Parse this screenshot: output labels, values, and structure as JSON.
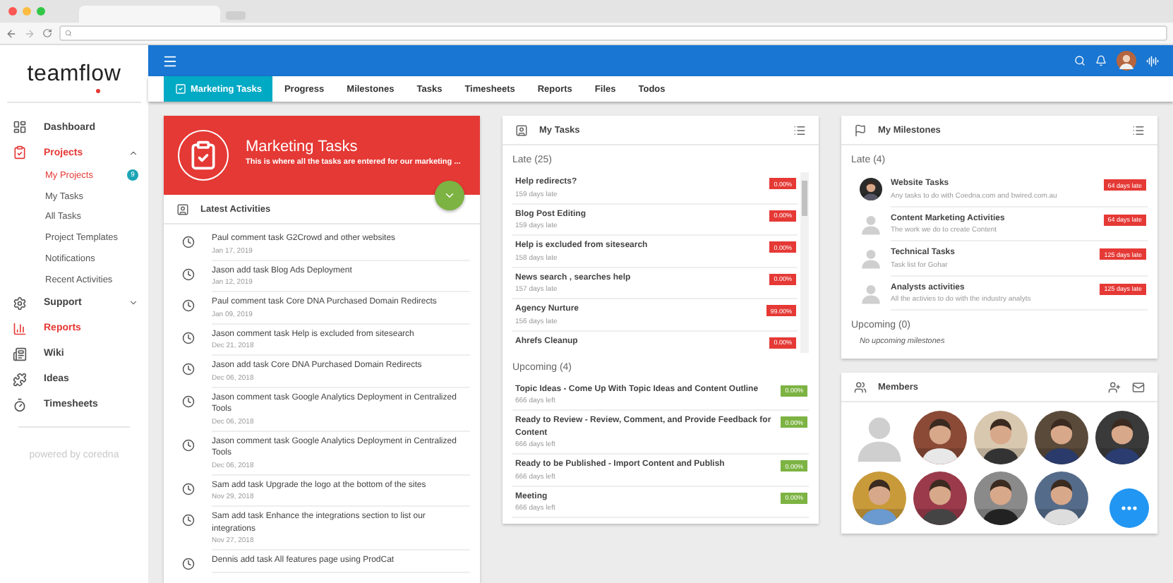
{
  "sidebar": {
    "logo": "teamflow",
    "items": [
      {
        "label": "Dashboard",
        "selected": false
      },
      {
        "label": "Projects",
        "selected": true,
        "expanded": true,
        "children": [
          {
            "label": "My Projects",
            "selected": true,
            "badge": "9"
          },
          {
            "label": "My Tasks",
            "selected": false
          },
          {
            "label": "All Tasks",
            "selected": false
          },
          {
            "label": "Project Templates",
            "selected": false
          },
          {
            "label": "Notifications",
            "selected": false
          },
          {
            "label": "Recent Activities",
            "selected": false
          }
        ]
      },
      {
        "label": "Support",
        "selected": false,
        "expanded": false
      },
      {
        "label": "Reports",
        "selected": true
      },
      {
        "label": "Wiki",
        "selected": false
      },
      {
        "label": "Ideas",
        "selected": false
      },
      {
        "label": "Timesheets",
        "selected": false
      }
    ],
    "footer": "powered by coredna"
  },
  "tabs": [
    {
      "label": "Marketing Tasks",
      "selected": true
    },
    {
      "label": "Progress",
      "selected": false
    },
    {
      "label": "Milestones",
      "selected": false
    },
    {
      "label": "Tasks",
      "selected": false
    },
    {
      "label": "Timesheets",
      "selected": false
    },
    {
      "label": "Reports",
      "selected": false
    },
    {
      "label": "Files",
      "selected": false
    },
    {
      "label": "Todos",
      "selected": false
    }
  ],
  "project": {
    "title": "Marketing Tasks",
    "description": "This is where all the tasks are entered for our marketing ..."
  },
  "activities": {
    "title": "Latest Activities",
    "items": [
      {
        "text": "Paul comment task G2Crowd and other websites",
        "date": "Jan 17, 2019"
      },
      {
        "text": "Jason add task Blog Ads Deployment",
        "date": "Jan 12, 2019"
      },
      {
        "text": "Paul comment task Core DNA Purchased Domain Redirects",
        "date": "Jan 09, 2019"
      },
      {
        "text": "Jason comment task Help is excluded from sitesearch",
        "date": "Dec 21, 2018"
      },
      {
        "text": "Jason add task Core DNA Purchased Domain Redirects",
        "date": "Dec 06, 2018"
      },
      {
        "text": "Jason comment task Google Analytics Deployment in Centralized Tools",
        "date": "Dec 06, 2018"
      },
      {
        "text": "Jason comment task Google Analytics Deployment in Centralized Tools",
        "date": "Dec 06, 2018"
      },
      {
        "text": "Sam add task Upgrade the logo at the bottom of the sites",
        "date": "Nov 29, 2018"
      },
      {
        "text": "Sam add task Enhance the integrations section to list our integrations",
        "date": "Nov 27, 2018"
      },
      {
        "text": "Dennis add task All features page using ProdCat"
      }
    ]
  },
  "my_tasks": {
    "title": "My Tasks",
    "sections": [
      {
        "kind": "late",
        "heading": "Late (25)",
        "tasks": [
          {
            "title": "Help redirects?",
            "due": "159 days late",
            "progress": "0.00%"
          },
          {
            "title": "Blog Post Editing",
            "due": "159 days late",
            "progress": "0.00%"
          },
          {
            "title": "Help is excluded from sitesearch",
            "due": "158 days late",
            "progress": "0.00%"
          },
          {
            "title": "News search , searches help",
            "due": "157 days late",
            "progress": "0.00%"
          },
          {
            "title": "Agency Nurture",
            "due": "156 days late",
            "progress": "99.00%"
          },
          {
            "title": "Ahrefs Cleanup",
            "progress": "0.00%"
          }
        ]
      },
      {
        "kind": "upcoming",
        "heading": "Upcoming (4)",
        "tasks": [
          {
            "title": "Topic Ideas - Come Up With Topic Ideas and Content Outline",
            "due": "666 days left",
            "progress": "0.00%"
          },
          {
            "title": "Ready to Review - Review, Comment, and Provide Feedback for Content",
            "due": "666 days left",
            "progress": "0.00%"
          },
          {
            "title": "Ready to be Published - Import Content and Publish",
            "due": "666 days left",
            "progress": "0.00%"
          },
          {
            "title": "Meeting",
            "due": "666 days left",
            "progress": "0.00%"
          }
        ]
      }
    ]
  },
  "milestones": {
    "title": "My Milestones",
    "sections": [
      {
        "heading": "Late (4)",
        "items": [
          {
            "title": "Website Tasks",
            "description": "Any tasks to do with Coedna.com and bwired.com.au",
            "badge": "64 days late",
            "kind": "picture"
          },
          {
            "title": "Content Marketing Activities",
            "description": "The work we do to create Content",
            "badge": "64 days late",
            "kind": "placeholder"
          },
          {
            "title": "Technical Tasks",
            "description": "Task list for Gohar",
            "badge": "125 days late",
            "kind": "placeholder"
          },
          {
            "title": "Analysts activities",
            "description": "All the activies to do with the industry analyts",
            "badge": "125 days late",
            "kind": "placeholder"
          }
        ]
      },
      {
        "heading": "Upcoming (0)",
        "empty_text": "No upcoming milestones"
      }
    ]
  },
  "members": {
    "title": "Members",
    "people": [
      {
        "kind": "placeholder"
      },
      {
        "kind": "picture"
      },
      {
        "kind": "picture"
      },
      {
        "kind": "picture"
      },
      {
        "kind": "picture"
      },
      {
        "kind": "picture"
      },
      {
        "kind": "picture"
      },
      {
        "kind": "picture"
      },
      {
        "kind": "picture"
      }
    ]
  }
}
